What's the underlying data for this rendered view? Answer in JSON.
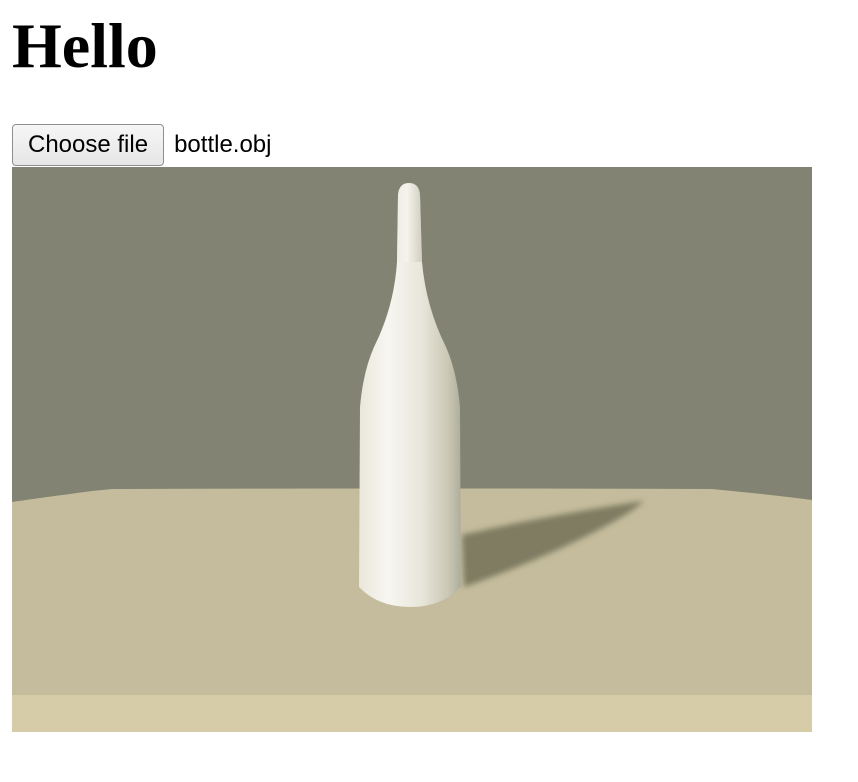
{
  "page": {
    "heading": "Hello"
  },
  "file_input": {
    "button_label": "Choose file",
    "selected_file": "bottle.obj"
  },
  "scene": {
    "object": "bottle",
    "colors": {
      "wall": "#828373",
      "table": "#c4bc9c",
      "table_front": "#d6cca8",
      "bottle": "#f0efe8",
      "shadow": "#7f7b62"
    }
  }
}
